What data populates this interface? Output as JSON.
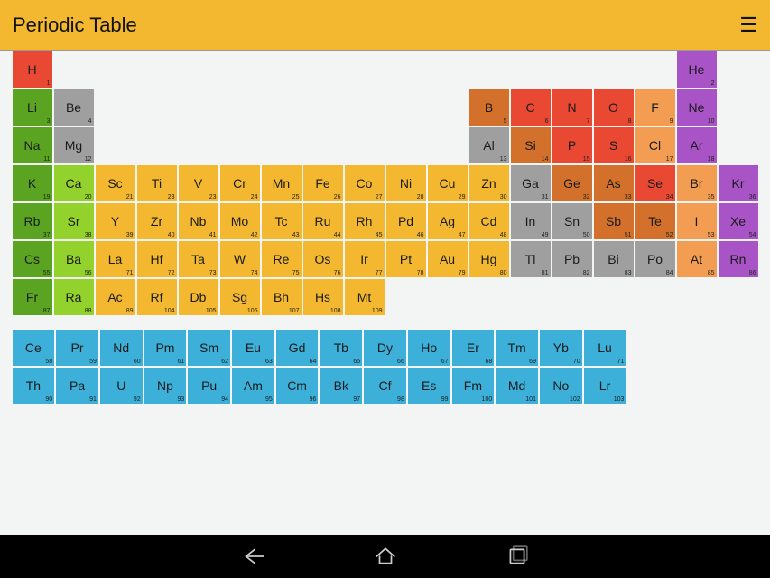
{
  "header": {
    "title": "Periodic Table"
  },
  "palette": {
    "alkali": "#5ba421",
    "alkaline": "#93d22d",
    "transition": "#f4b830",
    "posttrans": "#9f9f9f",
    "metalloid": "#d3712c",
    "nonmetal_red": "#e94832",
    "nonmetal_orange": "#f39d53",
    "halogen": "#f4b830",
    "noble": "#a853c6",
    "lanthanide": "#3db0da",
    "actinide": "#3db0da",
    "h_red": "#e94832"
  },
  "main": [
    [
      {
        "sym": "H",
        "num": 1,
        "c": "h_red"
      },
      null,
      null,
      null,
      null,
      null,
      null,
      null,
      null,
      null,
      null,
      null,
      null,
      null,
      null,
      null,
      {
        "sym": "He",
        "num": 2,
        "c": "noble"
      }
    ],
    [
      {
        "sym": "Li",
        "num": 3,
        "c": "alkali"
      },
      {
        "sym": "Be",
        "num": 4,
        "c": "posttrans"
      },
      null,
      null,
      null,
      null,
      null,
      null,
      null,
      null,
      null,
      {
        "sym": "B",
        "num": 5,
        "c": "metalloid"
      },
      {
        "sym": "C",
        "num": 6,
        "c": "nonmetal_red"
      },
      {
        "sym": "N",
        "num": 7,
        "c": "nonmetal_red"
      },
      {
        "sym": "O",
        "num": 8,
        "c": "nonmetal_red"
      },
      {
        "sym": "F",
        "num": 9,
        "c": "nonmetal_orange"
      },
      {
        "sym": "Ne",
        "num": 10,
        "c": "noble"
      }
    ],
    [
      {
        "sym": "Na",
        "num": 11,
        "c": "alkali"
      },
      {
        "sym": "Mg",
        "num": 12,
        "c": "posttrans"
      },
      null,
      null,
      null,
      null,
      null,
      null,
      null,
      null,
      null,
      {
        "sym": "Al",
        "num": 13,
        "c": "posttrans"
      },
      {
        "sym": "Si",
        "num": 14,
        "c": "metalloid"
      },
      {
        "sym": "P",
        "num": 15,
        "c": "nonmetal_red"
      },
      {
        "sym": "S",
        "num": 16,
        "c": "nonmetal_red"
      },
      {
        "sym": "Cl",
        "num": 17,
        "c": "nonmetal_orange"
      },
      {
        "sym": "Ar",
        "num": 18,
        "c": "noble"
      }
    ],
    [
      {
        "sym": "K",
        "num": 19,
        "c": "alkali"
      },
      {
        "sym": "Ca",
        "num": 20,
        "c": "alkaline"
      },
      {
        "sym": "Sc",
        "num": 21,
        "c": "transition"
      },
      {
        "sym": "Ti",
        "num": 23,
        "c": "transition"
      },
      {
        "sym": "V",
        "num": 23,
        "c": "transition"
      },
      {
        "sym": "Cr",
        "num": 24,
        "c": "transition"
      },
      {
        "sym": "Mn",
        "num": 25,
        "c": "transition"
      },
      {
        "sym": "Fe",
        "num": 26,
        "c": "transition"
      },
      {
        "sym": "Co",
        "num": 27,
        "c": "transition"
      },
      {
        "sym": "Ni",
        "num": 28,
        "c": "transition"
      },
      {
        "sym": "Cu",
        "num": 29,
        "c": "transition"
      },
      {
        "sym": "Zn",
        "num": 30,
        "c": "transition"
      },
      {
        "sym": "Ga",
        "num": 31,
        "c": "posttrans"
      },
      {
        "sym": "Ge",
        "num": 32,
        "c": "metalloid"
      },
      {
        "sym": "As",
        "num": 33,
        "c": "metalloid"
      },
      {
        "sym": "Se",
        "num": 34,
        "c": "nonmetal_red"
      },
      {
        "sym": "Br",
        "num": 35,
        "c": "nonmetal_orange"
      },
      {
        "sym": "Kr",
        "num": 36,
        "c": "noble"
      }
    ],
    [
      {
        "sym": "Rb",
        "num": 37,
        "c": "alkali"
      },
      {
        "sym": "Sr",
        "num": 38,
        "c": "alkaline"
      },
      {
        "sym": "Y",
        "num": 39,
        "c": "transition"
      },
      {
        "sym": "Zr",
        "num": 40,
        "c": "transition"
      },
      {
        "sym": "Nb",
        "num": 41,
        "c": "transition"
      },
      {
        "sym": "Mo",
        "num": 42,
        "c": "transition"
      },
      {
        "sym": "Tc",
        "num": 43,
        "c": "transition"
      },
      {
        "sym": "Ru",
        "num": 44,
        "c": "transition"
      },
      {
        "sym": "Rh",
        "num": 45,
        "c": "transition"
      },
      {
        "sym": "Pd",
        "num": 46,
        "c": "transition"
      },
      {
        "sym": "Ag",
        "num": 47,
        "c": "transition"
      },
      {
        "sym": "Cd",
        "num": 48,
        "c": "transition"
      },
      {
        "sym": "In",
        "num": 49,
        "c": "posttrans"
      },
      {
        "sym": "Sn",
        "num": 50,
        "c": "posttrans"
      },
      {
        "sym": "Sb",
        "num": 51,
        "c": "metalloid"
      },
      {
        "sym": "Te",
        "num": 52,
        "c": "metalloid"
      },
      {
        "sym": "I",
        "num": 53,
        "c": "nonmetal_orange"
      },
      {
        "sym": "Xe",
        "num": 54,
        "c": "noble"
      }
    ],
    [
      {
        "sym": "Cs",
        "num": 55,
        "c": "alkali"
      },
      {
        "sym": "Ba",
        "num": 56,
        "c": "alkaline"
      },
      {
        "sym": "La",
        "num": 71,
        "c": "transition"
      },
      {
        "sym": "Hf",
        "num": 72,
        "c": "transition"
      },
      {
        "sym": "Ta",
        "num": 73,
        "c": "transition"
      },
      {
        "sym": "W",
        "num": 74,
        "c": "transition"
      },
      {
        "sym": "Re",
        "num": 75,
        "c": "transition"
      },
      {
        "sym": "Os",
        "num": 76,
        "c": "transition"
      },
      {
        "sym": "Ir",
        "num": 77,
        "c": "transition"
      },
      {
        "sym": "Pt",
        "num": 78,
        "c": "transition"
      },
      {
        "sym": "Au",
        "num": 79,
        "c": "transition"
      },
      {
        "sym": "Hg",
        "num": 80,
        "c": "transition"
      },
      {
        "sym": "Tl",
        "num": 81,
        "c": "posttrans"
      },
      {
        "sym": "Pb",
        "num": 82,
        "c": "posttrans"
      },
      {
        "sym": "Bi",
        "num": 83,
        "c": "posttrans"
      },
      {
        "sym": "Po",
        "num": 84,
        "c": "posttrans"
      },
      {
        "sym": "At",
        "num": 85,
        "c": "nonmetal_orange"
      },
      {
        "sym": "Rn",
        "num": 86,
        "c": "noble"
      }
    ],
    [
      {
        "sym": "Fr",
        "num": 87,
        "c": "alkali"
      },
      {
        "sym": "Ra",
        "num": 88,
        "c": "alkaline"
      },
      {
        "sym": "Ac",
        "num": 89,
        "c": "transition"
      },
      {
        "sym": "Rf",
        "num": 104,
        "c": "transition"
      },
      {
        "sym": "Db",
        "num": 105,
        "c": "transition"
      },
      {
        "sym": "Sg",
        "num": 106,
        "c": "transition"
      },
      {
        "sym": "Bh",
        "num": 107,
        "c": "transition"
      },
      {
        "sym": "Hs",
        "num": 108,
        "c": "transition"
      },
      {
        "sym": "Mt",
        "num": 109,
        "c": "transition"
      },
      null,
      null,
      null,
      null,
      null,
      null,
      null,
      null,
      null
    ]
  ],
  "extra": [
    [
      {
        "sym": "Ce",
        "num": 58,
        "c": "lanthanide"
      },
      {
        "sym": "Pr",
        "num": 59,
        "c": "lanthanide"
      },
      {
        "sym": "Nd",
        "num": 60,
        "c": "lanthanide"
      },
      {
        "sym": "Pm",
        "num": 61,
        "c": "lanthanide"
      },
      {
        "sym": "Sm",
        "num": 62,
        "c": "lanthanide"
      },
      {
        "sym": "Eu",
        "num": 63,
        "c": "lanthanide"
      },
      {
        "sym": "Gd",
        "num": 64,
        "c": "lanthanide"
      },
      {
        "sym": "Tb",
        "num": 65,
        "c": "lanthanide"
      },
      {
        "sym": "Dy",
        "num": 66,
        "c": "lanthanide"
      },
      {
        "sym": "Ho",
        "num": 67,
        "c": "lanthanide"
      },
      {
        "sym": "Er",
        "num": 68,
        "c": "lanthanide"
      },
      {
        "sym": "Tm",
        "num": 69,
        "c": "lanthanide"
      },
      {
        "sym": "Yb",
        "num": 70,
        "c": "lanthanide"
      },
      {
        "sym": "Lu",
        "num": 71,
        "c": "lanthanide"
      },
      null,
      null,
      null
    ],
    [
      {
        "sym": "Th",
        "num": 90,
        "c": "actinide"
      },
      {
        "sym": "Pa",
        "num": 91,
        "c": "actinide"
      },
      {
        "sym": "U",
        "num": 92,
        "c": "actinide"
      },
      {
        "sym": "Np",
        "num": 93,
        "c": "actinide"
      },
      {
        "sym": "Pu",
        "num": 94,
        "c": "actinide"
      },
      {
        "sym": "Am",
        "num": 95,
        "c": "actinide"
      },
      {
        "sym": "Cm",
        "num": 96,
        "c": "actinide"
      },
      {
        "sym": "Bk",
        "num": 97,
        "c": "actinide"
      },
      {
        "sym": "Cf",
        "num": 98,
        "c": "actinide"
      },
      {
        "sym": "Es",
        "num": 99,
        "c": "actinide"
      },
      {
        "sym": "Fm",
        "num": 100,
        "c": "actinide"
      },
      {
        "sym": "Md",
        "num": 101,
        "c": "actinide"
      },
      {
        "sym": "No",
        "num": 102,
        "c": "actinide"
      },
      {
        "sym": "Lr",
        "num": 103,
        "c": "actinide"
      },
      null,
      null,
      null
    ]
  ]
}
